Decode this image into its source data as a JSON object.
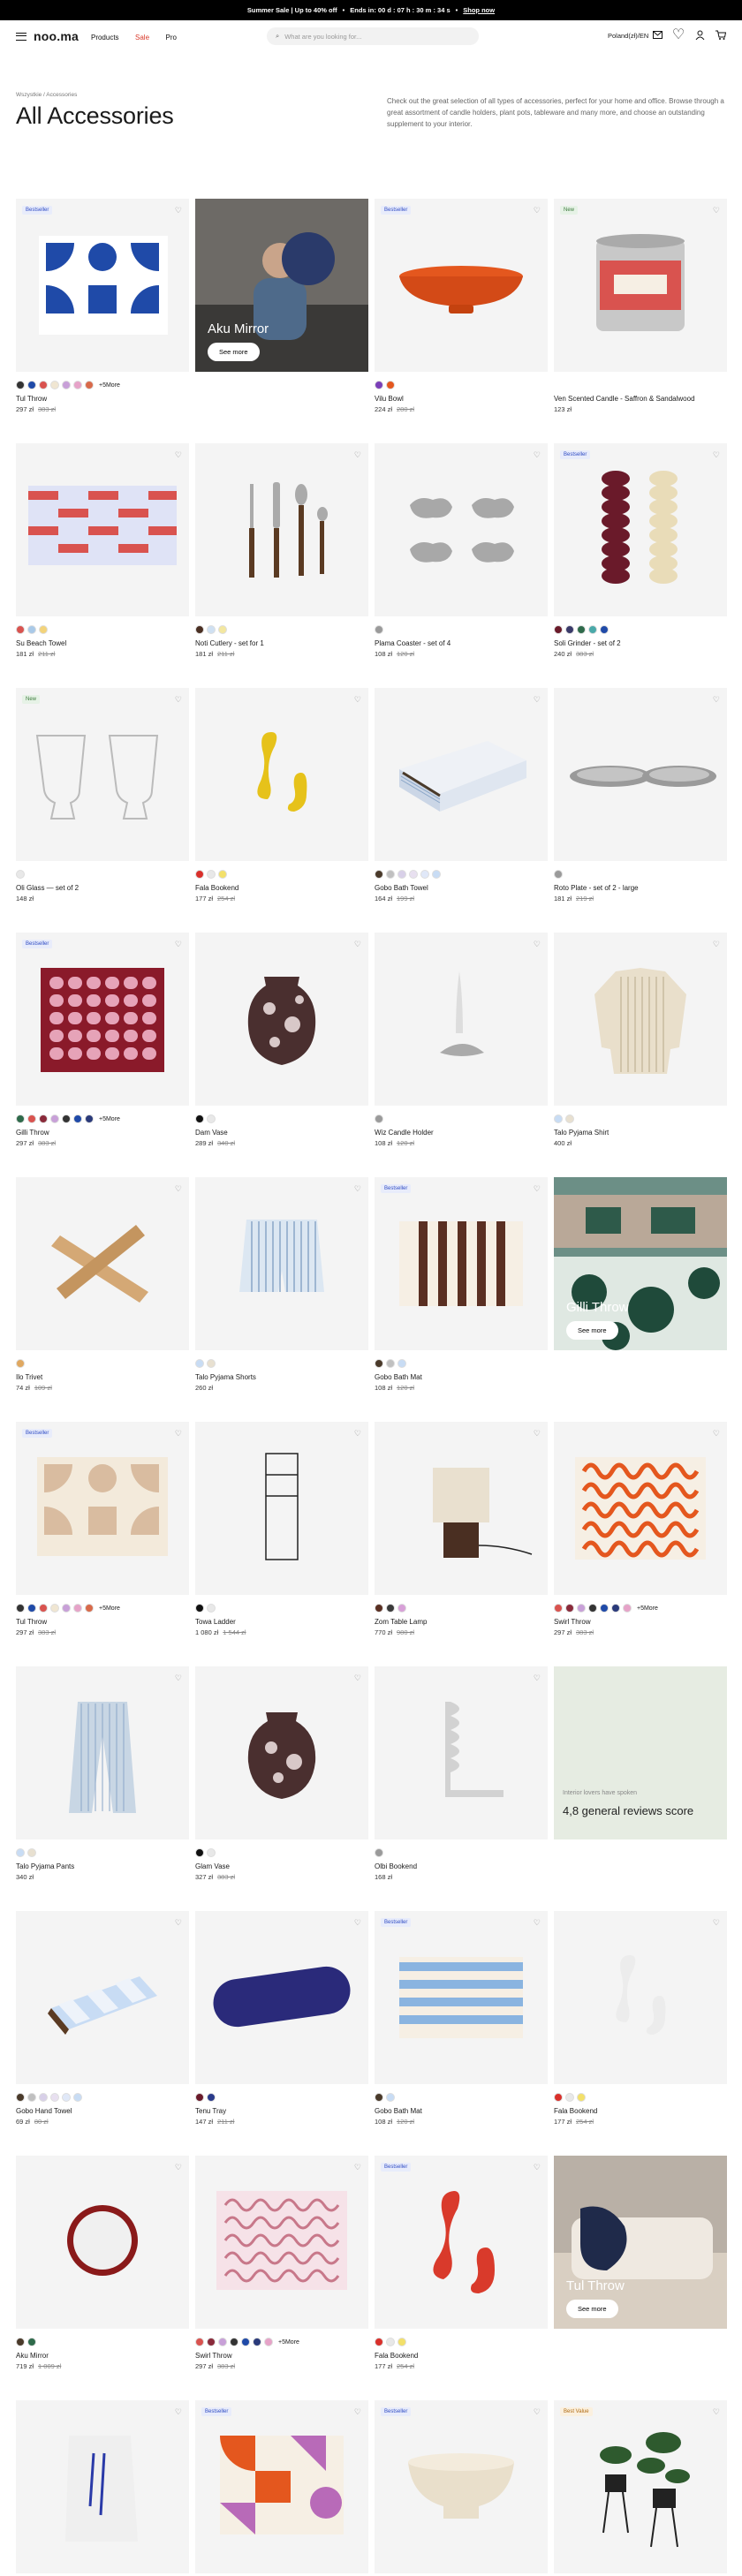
{
  "promo": {
    "left": "Summer Sale | Up to 40% off",
    "sep": "•",
    "ends": "Ends in: 00 d : 07 h : 30 m : 34 s",
    "sep2": "•",
    "link": "Shop now"
  },
  "header": {
    "logo": "noo.ma",
    "nav": [
      "Products",
      "Sale",
      "Pro"
    ],
    "search_placeholder": "What are you looking for...",
    "region": "Poland(zł)/EN"
  },
  "breadcrumb": "Wszystkie / Accessories",
  "title": "All Accessories",
  "intro": "Check out the great selection of all types of accessories, perfect for your home and office. Browse through a great assortment of candle holders, plant pots, tableware and many more, and choose an outstanding supplement to your interior.",
  "colors": {
    "blue": "#1f4aa8",
    "orange": "#e4571e",
    "red": "#d93a2b",
    "bg": "#f4f4f4"
  },
  "products": [
    {
      "name": "Tul Throw",
      "price": "297 zł",
      "old": "383 zł",
      "badge": "Bestseller",
      "swatches": [
        "#333",
        "#1f4aa8",
        "#d9534f",
        "#f0e6d2",
        "#c8a0d8",
        "#e6a3c8",
        "#d86a4a"
      ],
      "more": "+5More"
    },
    {
      "overlay": "Aku Mirror",
      "btn": "See more"
    },
    {
      "name": "Vilu Bowl",
      "price": "224 zł",
      "old": "280 zł",
      "badge": "Bestseller",
      "swatches": [
        "#7a3fb8",
        "#e4571e"
      ]
    },
    {
      "name": "Ven Scented Candle - Saffron & Sandalwood",
      "price": "123 zł",
      "badge": "New"
    },
    {
      "name": "Su Beach Towel",
      "price": "181 zł",
      "old": "211 zł",
      "swatches": [
        "#d9534f",
        "#a9c9e8",
        "#f3d37a"
      ]
    },
    {
      "name": "Noti Cutlery - set for 1",
      "price": "181 zł",
      "old": "211 zł",
      "swatches": [
        "#4a2f22",
        "#cfe0f2",
        "#f3e7a0"
      ]
    },
    {
      "name": "Plama Coaster - set of 4",
      "price": "108 zł",
      "old": "120 zł",
      "swatches": [
        "#9a9a9a"
      ]
    },
    {
      "name": "Soli Grinder - set of 2",
      "price": "240 zł",
      "old": "383 zł",
      "badge": "Bestseller",
      "swatches": [
        "#6a1a2a",
        "#3a3a6a",
        "#2e6a4a",
        "#4aa9a9",
        "#1f4aa8"
      ]
    },
    {
      "name": "Oli Glass — set of 2",
      "price": "148 zł",
      "badge": "New",
      "swatches": [
        "#e8e8e8"
      ]
    },
    {
      "name": "Fala Bookend",
      "price": "177 zł",
      "old": "254 zł",
      "swatches": [
        "#d9302b",
        "#e8e8e8",
        "#f3e06a"
      ]
    },
    {
      "name": "Gobo Bath Towel",
      "price": "164 zł",
      "old": "199 zł",
      "swatches": [
        "#4a3a2a",
        "#c0c0c0",
        "#d8d0e8",
        "#e8e0f0",
        "#e0e8f8",
        "#c8dcf4"
      ]
    },
    {
      "name": "Roto Plate - set of 2 - large",
      "price": "181 zł",
      "old": "219 zł",
      "swatches": [
        "#9a9a9a"
      ]
    },
    {
      "name": "Gilli Throw",
      "price": "297 zł",
      "old": "383 zł",
      "badge": "Bestseller",
      "swatches": [
        "#2e6a4a",
        "#d9534f",
        "#8a2a3a",
        "#c8a0d8",
        "#333",
        "#1f4aa8",
        "#2a3a7a"
      ],
      "more": "+5More"
    },
    {
      "name": "Dam Vase",
      "price": "289 zł",
      "old": "340 zł",
      "swatches": [
        "#111",
        "#e8e8e8"
      ]
    },
    {
      "name": "Wiz Candle Holder",
      "price": "108 zł",
      "old": "120 zł",
      "swatches": [
        "#9a9a9a"
      ]
    },
    {
      "name": "Talo Pyjama Shirt",
      "price": "400 zł",
      "swatches": [
        "#c8dcf4",
        "#e8e0d0"
      ]
    },
    {
      "name": "Ilo Trivet",
      "price": "74 zł",
      "old": "109 zł",
      "swatches": [
        "#e0a860"
      ]
    },
    {
      "name": "Talo Pyjama Shorts",
      "price": "260 zł",
      "swatches": [
        "#c8dcf4",
        "#e8e0d0"
      ]
    },
    {
      "name": "Gobo Bath Mat",
      "price": "108 zł",
      "old": "120 zł",
      "badge": "Bestseller",
      "swatches": [
        "#4a3a2a",
        "#c0c0c0",
        "#c8dcf4"
      ]
    },
    {
      "overlay": "Gilli Throw",
      "btn": "See more"
    },
    {
      "name": "Tul Throw",
      "price": "297 zł",
      "old": "383 zł",
      "badge": "Bestseller",
      "swatches": [
        "#333",
        "#1f4aa8",
        "#d9534f",
        "#f0e6d2",
        "#c8a0d8",
        "#e6a3c8",
        "#d86a4a"
      ],
      "more": "+5More"
    },
    {
      "name": "Towa Ladder",
      "price": "1 080 zł",
      "old": "1 544 zł",
      "swatches": [
        "#111",
        "#e8e8e8"
      ]
    },
    {
      "name": "Zom Table Lamp",
      "price": "770 zł",
      "old": "980 zł",
      "swatches": [
        "#5a2f22",
        "#3a3a3a",
        "#d8a0d8"
      ]
    },
    {
      "name": "Swirl Throw",
      "price": "297 zł",
      "old": "383 zł",
      "swatches": [
        "#d9534f",
        "#8a2a3a",
        "#c8a0d8",
        "#333",
        "#1f4aa8",
        "#2a3a7a",
        "#e6a3c8"
      ],
      "more": "+5More"
    },
    {
      "name": "Talo Pyjama Pants",
      "price": "340 zł",
      "swatches": [
        "#c8dcf4",
        "#e8e0d0"
      ]
    },
    {
      "name": "Glam Vase",
      "price": "327 zł",
      "old": "383 zł",
      "swatches": [
        "#111",
        "#e8e8e8"
      ]
    },
    {
      "name": "Olbi Bookend",
      "price": "168 zł",
      "swatches": [
        "#9a9a9a"
      ]
    },
    {
      "review_small": "Interior lovers have spoken",
      "review_big": "4,8 general reviews score"
    },
    {
      "name": "Gobo Hand Towel",
      "price": "69 zł",
      "old": "80 zł",
      "swatches": [
        "#4a3a2a",
        "#c0c0c0",
        "#d8d0e8",
        "#e8e0f0",
        "#e0e8f8",
        "#c8dcf4"
      ]
    },
    {
      "name": "Tenu Tray",
      "price": "147 zł",
      "old": "211 zł",
      "swatches": [
        "#6a1a2a",
        "#2a3a8a"
      ]
    },
    {
      "name": "Gobo Bath Mat",
      "price": "108 zł",
      "old": "120 zł",
      "badge": "Bestseller",
      "swatches": [
        "#4a3a2a",
        "#c8dcf4"
      ]
    },
    {
      "name": "Fala Bookend",
      "price": "177 zł",
      "old": "254 zł",
      "swatches": [
        "#d9302b",
        "#e8e8e8",
        "#f3e06a"
      ]
    },
    {
      "name": "Aku Mirror",
      "price": "719 zł",
      "old": "1 009 zł",
      "swatches": [
        "#4a3a2a",
        "#2e6a4a"
      ]
    },
    {
      "name": "Swirl Throw",
      "price": "297 zł",
      "old": "383 zł",
      "swatches": [
        "#d9534f",
        "#8a2a3a",
        "#c8a0d8",
        "#333",
        "#1f4aa8",
        "#2a3a7a",
        "#e6a3c8"
      ],
      "more": "+5More"
    },
    {
      "name": "Fala Bookend",
      "price": "177 zł",
      "old": "254 zł",
      "badge": "Bestseller",
      "swatches": [
        "#d9302b",
        "#e8e8e8",
        "#f3e06a"
      ]
    },
    {
      "overlay": "Tul Throw",
      "btn": "See more"
    },
    {
      "name": "",
      "badge": ""
    },
    {
      "name": "",
      "badge": "Bestseller"
    },
    {
      "name": "",
      "badge": "Bestseller"
    },
    {
      "name": "",
      "badge": "Best Value"
    }
  ]
}
